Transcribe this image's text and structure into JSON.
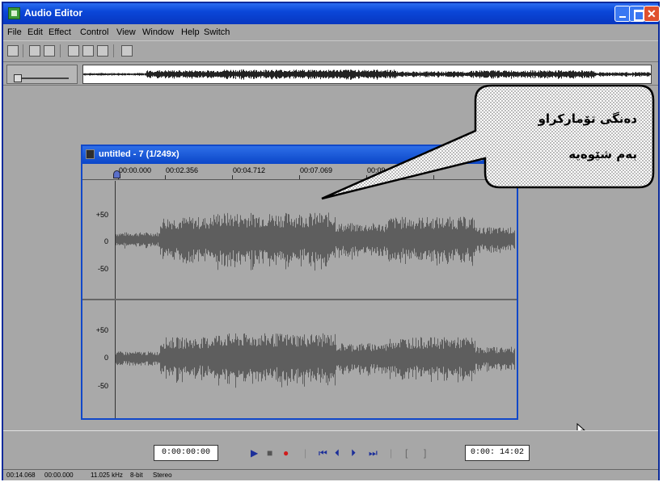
{
  "app": {
    "title": "Audio Editor"
  },
  "menu": [
    "File",
    "Edit",
    "Effect",
    "Control",
    "View",
    "Window",
    "Help",
    "Switch"
  ],
  "document": {
    "title": "untitled - 7 (1/249x)",
    "ruler": [
      "00:00.000",
      "00:02.356",
      "00:04.712",
      "00:07.069",
      "00:09.425"
    ],
    "track_labels": [
      "+50",
      "0",
      "-50"
    ]
  },
  "callout": {
    "line1": "دەنگی تۆمارکراو",
    "line2": "بەم شێوەیە"
  },
  "transport": {
    "position_time": "0:00:00:00",
    "length_time": "0:00: 14:02"
  },
  "status": {
    "time1": "00:14.068",
    "time2": "00:00.000",
    "rate": "11.025 kHz",
    "bits": "8-bit",
    "channels": "Stereo"
  },
  "colors": {
    "titlebar": "#0a46d8",
    "waveform": "#5e5e5e",
    "workspace": "#a7a7a7"
  }
}
